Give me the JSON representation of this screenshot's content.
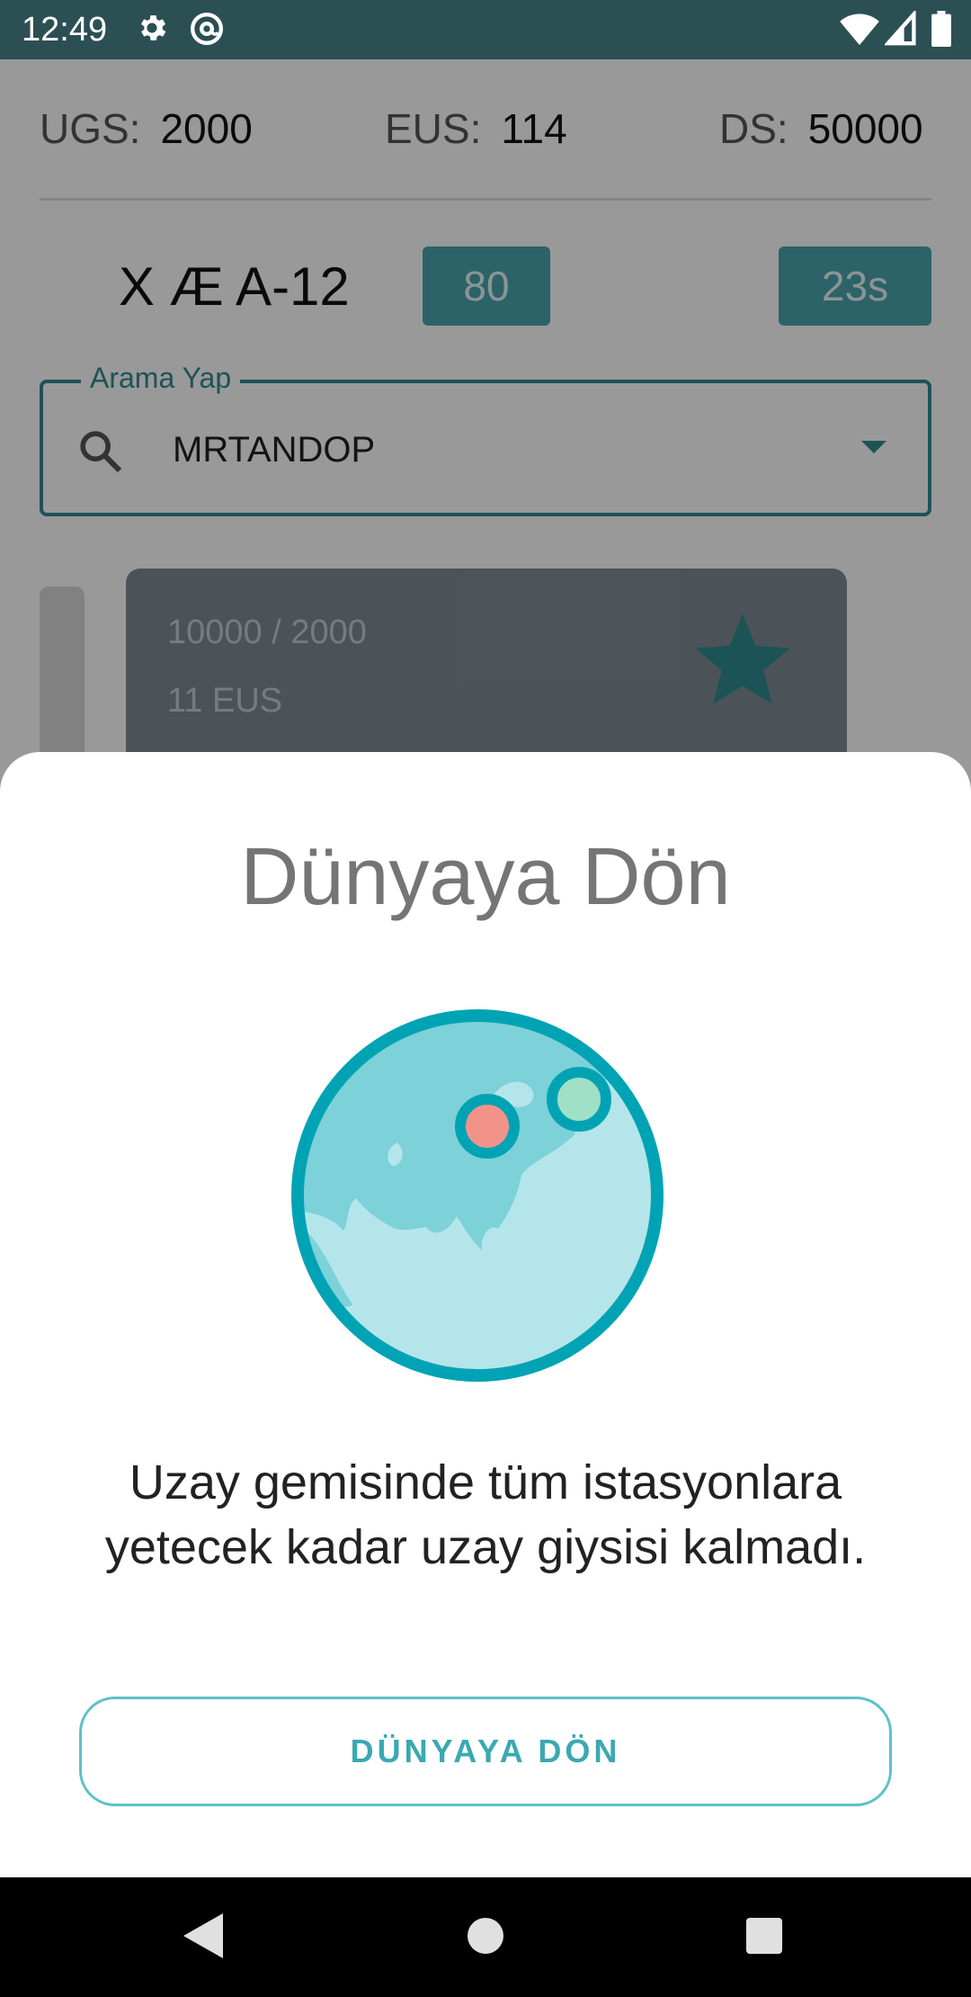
{
  "status_bar": {
    "time": "12:49",
    "icons": [
      "gear-icon",
      "at-sign-icon",
      "wifi-icon",
      "signal-icon",
      "battery-icon"
    ]
  },
  "stats": {
    "ugs": {
      "label": "UGS:",
      "value": "2000"
    },
    "eus": {
      "label": "EUS:",
      "value": "114"
    },
    "ds": {
      "label": "DS:",
      "value": "50000"
    }
  },
  "ship": {
    "name": "X Æ A-12",
    "badge_value": "80",
    "timer": "23s"
  },
  "search": {
    "legend": "Arama Yap",
    "value": "MRTANDOP"
  },
  "station_card": {
    "line1": "10000 / 2000",
    "line2": "11 EUS"
  },
  "sheet": {
    "title": "Dünyaya Dön",
    "message": "Uzay gemisinde tüm istasyonlara yetecek kadar uzay giysisi kalmadı.",
    "button_label": "DÜNYAYA DÖN"
  },
  "colors": {
    "accent": "#2f8a92",
    "status_bar": "#2c4f53",
    "button_text": "#3aa9b1",
    "globe_ring": "#00a3b4"
  }
}
